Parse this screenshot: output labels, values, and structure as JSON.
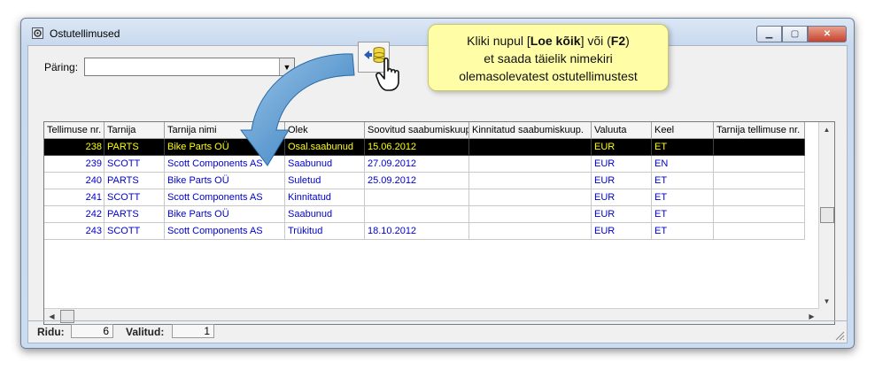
{
  "window": {
    "title": "Ostutellimused"
  },
  "query": {
    "label": "Päring:",
    "value": ""
  },
  "toolbar": {
    "load_all_tooltip": ""
  },
  "callout": {
    "line1_a": "Kliki nupul [",
    "line1_b": "Loe kõik",
    "line1_c": "] või (",
    "line1_d": "F2",
    "line1_e": ")",
    "line2": "et saada täielik nimekiri",
    "line3": "olemasolevatest ostutellimustest"
  },
  "table": {
    "columns": [
      "Tellimuse nr.",
      "Tarnija",
      "Tarnija nimi",
      "Olek",
      "Soovitud saabumiskuup.",
      "Kinnitatud saabumiskuup.",
      "Valuuta",
      "Keel",
      "Tarnija tellimuse nr."
    ],
    "rows": [
      [
        "238",
        "PARTS",
        "Bike Parts OÜ",
        "Osal.saabunud",
        "15.06.2012",
        "",
        "EUR",
        "ET",
        ""
      ],
      [
        "239",
        "SCOTT",
        "Scott Components AS",
        "Saabunud",
        "27.09.2012",
        "",
        "EUR",
        "EN",
        ""
      ],
      [
        "240",
        "PARTS",
        "Bike Parts OÜ",
        "Suletud",
        "25.09.2012",
        "",
        "EUR",
        "ET",
        ""
      ],
      [
        "241",
        "SCOTT",
        "Scott Components AS",
        "Kinnitatud",
        "",
        "",
        "EUR",
        "ET",
        ""
      ],
      [
        "242",
        "PARTS",
        "Bike Parts OÜ",
        "Saabunud",
        "",
        "",
        "EUR",
        "ET",
        ""
      ],
      [
        "243",
        "SCOTT",
        "Scott Components AS",
        "Trükitud",
        "18.10.2012",
        "",
        "EUR",
        "ET",
        ""
      ]
    ],
    "selected_row": 0
  },
  "status": {
    "rows_label": "Ridu:",
    "rows_value": "6",
    "selected_label": "Valitud:",
    "selected_value": "1"
  },
  "colors": {
    "selection_bg": "#000000",
    "selection_fg": "#ffff00",
    "row_text": "#0000cc",
    "callout_bg": "#fffea6",
    "arrow": "#3d86c6"
  }
}
